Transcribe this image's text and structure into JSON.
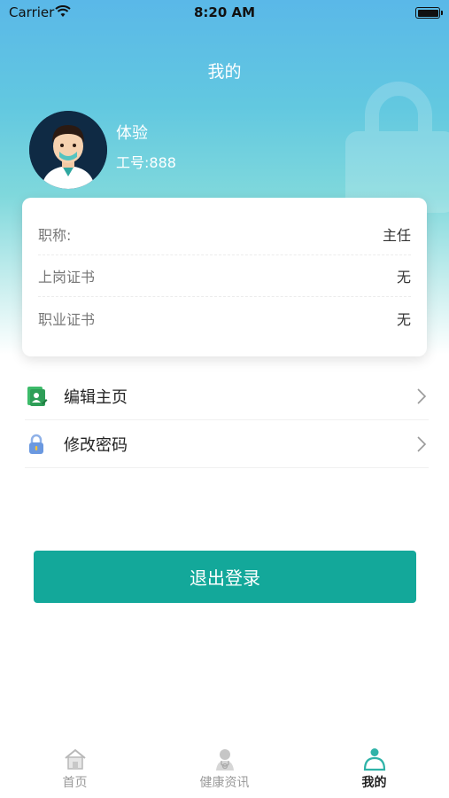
{
  "status_bar": {
    "carrier": "Carrier",
    "time": "8:20 AM"
  },
  "header": {
    "title": "我的"
  },
  "profile": {
    "name": "体验",
    "employee_id": "工号:888"
  },
  "info": {
    "rows": [
      {
        "label": "职称:",
        "value": "主任"
      },
      {
        "label": "上岗证书",
        "value": "无"
      },
      {
        "label": "职业证书",
        "value": "无"
      }
    ]
  },
  "menu": {
    "items": [
      {
        "label": "编辑主页",
        "icon": "edit-profile-icon"
      },
      {
        "label": "修改密码",
        "icon": "lock-icon"
      }
    ]
  },
  "logout": {
    "label": "退出登录"
  },
  "tabbar": {
    "tabs": [
      {
        "label": "首页",
        "icon": "home-icon"
      },
      {
        "label": "健康资讯",
        "icon": "doctor-icon"
      },
      {
        "label": "我的",
        "icon": "person-icon",
        "active": true
      }
    ]
  },
  "colors": {
    "accent": "#13a89a",
    "header_top": "#5ab8e8",
    "header_mid": "#7fd8dc"
  }
}
